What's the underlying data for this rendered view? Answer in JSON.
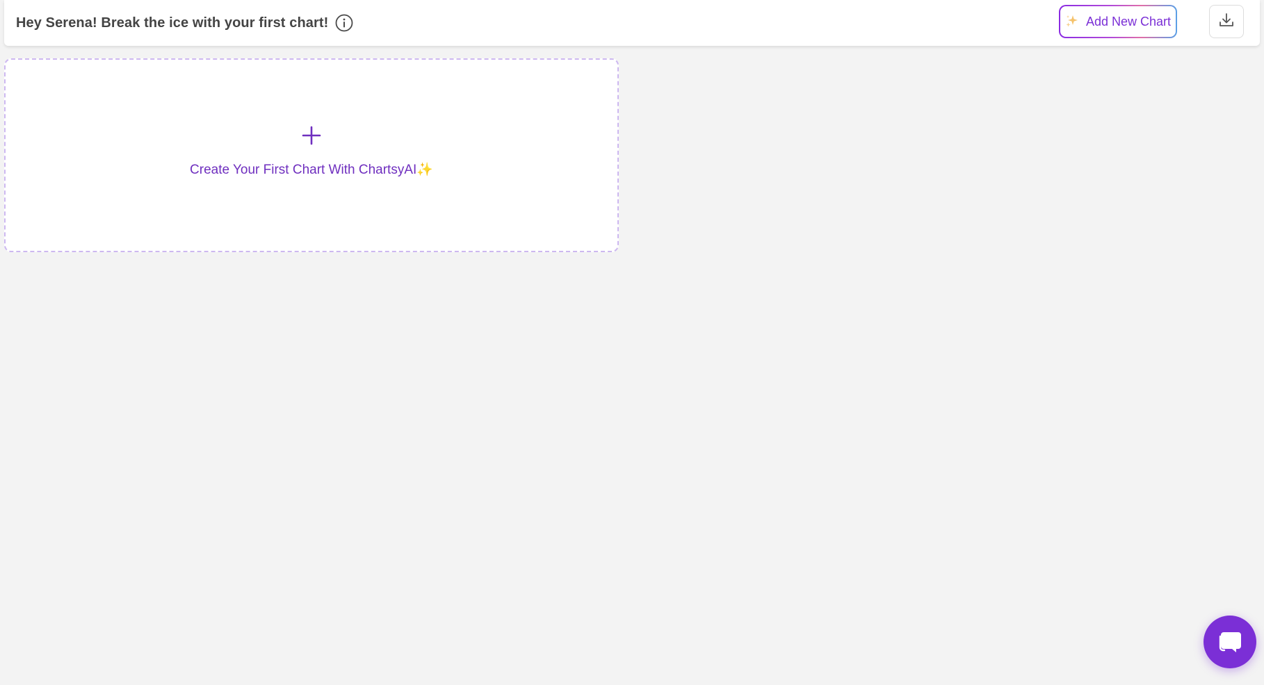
{
  "header": {
    "greeting": "Hey Serena! Break the ice with your first chart!",
    "info_icon": "info-circle-icon",
    "add_chart_label": "Add New Chart",
    "add_chart_icon": "sparkle-icon",
    "download_icon": "download-icon"
  },
  "main": {
    "create_card_label": "Create Your First Chart With ChartsyAI",
    "create_card_icon": "plus-icon",
    "create_card_emoji": "✨"
  },
  "chat": {
    "icon": "chat-icon"
  },
  "colors": {
    "accent": "#7b2fd6",
    "dashed_border": "#cdb8f0",
    "background": "#f3f3f3",
    "header_bg": "#ffffff"
  }
}
